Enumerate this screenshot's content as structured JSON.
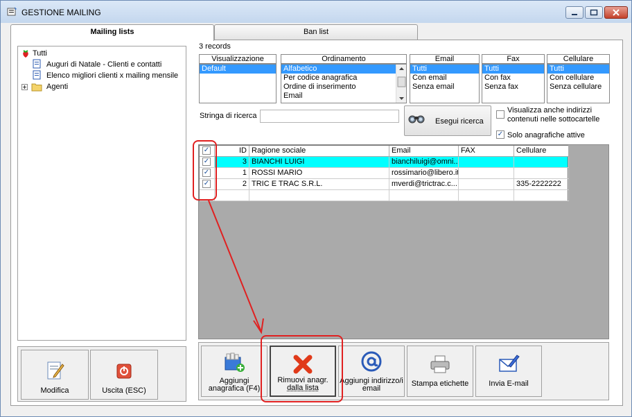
{
  "window": {
    "title": "GESTIONE MAILING"
  },
  "tabs": [
    {
      "label": "Mailing lists"
    },
    {
      "label": "Ban list"
    }
  ],
  "tree": {
    "root": "Tutti",
    "children": [
      "Auguri di Natale - Clienti e contatti",
      "Elenco migliori clienti x mailing mensile"
    ],
    "folder": "Agenti"
  },
  "left_buttons": {
    "modifica": "Modifica",
    "uscita": "Uscita (ESC)"
  },
  "records": "3 records",
  "filters": {
    "visualizzazione": {
      "label": "Visualizzazione",
      "options": [
        "Default"
      ]
    },
    "ordinamento": {
      "label": "Ordinamento",
      "options": [
        "Alfabetico",
        "Per codice anagrafica",
        "Ordine di inserimento",
        "Email"
      ]
    },
    "email": {
      "label": "Email",
      "options": [
        "Tutti",
        "Con email",
        "Senza email"
      ]
    },
    "fax": {
      "label": "Fax",
      "options": [
        "Tutti",
        "Con fax",
        "Senza fax"
      ]
    },
    "cellulare": {
      "label": "Cellulare",
      "options": [
        "Tutti",
        "Con cellulare",
        "Senza cellulare"
      ]
    }
  },
  "search": {
    "label": "Stringa di ricerca",
    "value": "",
    "button": "Esegui ricerca",
    "opt_sub_1": "Visualizza anche indirizzi",
    "opt_sub_2": "contenuti nelle sottocartelle",
    "opt_active": "Solo anagrafiche attive"
  },
  "grid": {
    "headers": [
      "ID",
      "Ragione sociale",
      "Email",
      "FAX",
      "Cellulare"
    ],
    "rows": [
      {
        "id": "3",
        "ragione": "BIANCHI LUIGI",
        "email": "bianchiluigi@omni...",
        "fax": "",
        "cell": ""
      },
      {
        "id": "1",
        "ragione": "ROSSI MARIO",
        "email": "rossimario@libero.it",
        "fax": "",
        "cell": ""
      },
      {
        "id": "2",
        "ragione": "TRIC E TRAC S.R.L.",
        "email": "mverdi@trictrac.c...",
        "fax": "",
        "cell": "335-2222222"
      }
    ]
  },
  "actions": {
    "add": [
      "Aggiungi",
      "anagrafica (F4)"
    ],
    "remove": [
      "Rimuovi anagr.",
      "dalla lista"
    ],
    "add_email": [
      "Aggiungi indirizzo/i",
      "email"
    ],
    "print": "Stampa etichette",
    "send": "Invia E-mail"
  },
  "colors": {
    "selected_row": "#00ffff",
    "selection": "#3399ff",
    "annotation": "#e02020"
  }
}
